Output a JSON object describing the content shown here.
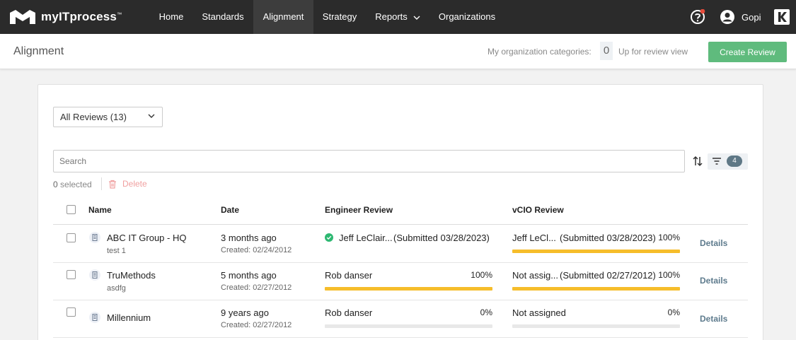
{
  "app": {
    "name": "myITprocess",
    "nav": [
      {
        "label": "Home"
      },
      {
        "label": "Standards"
      },
      {
        "label": "Alignment",
        "active": true
      },
      {
        "label": "Strategy"
      },
      {
        "label": "Reports"
      },
      {
        "label": "Organizations"
      }
    ],
    "user": "Gopi",
    "icons": {
      "help": "help-circle-icon",
      "user": "account-circle-icon",
      "brand": "kaseya-k-icon"
    },
    "notification_dot_color": "#e74c3c"
  },
  "subheader": {
    "title": "Alignment",
    "categories_label": "My organization categories:",
    "categories_count": "0",
    "review_view_label": "Up for review view",
    "create_button": "Create Review",
    "create_button_color": "#5fbb7d"
  },
  "toolbar": {
    "filter_select": "All Reviews (13)",
    "search_placeholder": "Search",
    "filter_count": "4",
    "selected_count": "0",
    "selected_label": "selected",
    "delete_label": "Delete"
  },
  "table": {
    "headers": {
      "name": "Name",
      "date": "Date",
      "engineer": "Engineer Review",
      "vcio": "vCIO Review"
    },
    "rows": [
      {
        "name": "ABC IT Group - HQ",
        "subtitle": "test 1",
        "date": "3 months ago",
        "created": "Created: 02/24/2012",
        "engineer": {
          "name": "Jeff LeClair...",
          "status": "(Submitted 03/28/2023)",
          "pct": "",
          "progress": 1.0,
          "show_bar": false,
          "submitted_icon": true
        },
        "vcio": {
          "name": "Jeff LeCl...",
          "status": "(Submitted 03/28/2023)",
          "pct": "100%",
          "progress": 1.0
        },
        "details": "Details"
      },
      {
        "name": "TruMethods",
        "subtitle": "asdfg",
        "date": "5 months ago",
        "created": "Created: 02/27/2012",
        "engineer": {
          "name": "Rob danser",
          "status": "",
          "pct": "100%",
          "progress": 1.0,
          "show_bar": true,
          "submitted_icon": false
        },
        "vcio": {
          "name": "Not assig...",
          "status": "(Submitted 02/27/2012)",
          "pct": "100%",
          "progress": 1.0
        },
        "details": "Details"
      },
      {
        "name": "Millennium",
        "subtitle": "",
        "date": "9 years ago",
        "created": "Created: 02/27/2012",
        "engineer": {
          "name": "Rob danser",
          "status": "",
          "pct": "0%",
          "progress": 0.0,
          "show_bar": true,
          "submitted_icon": false
        },
        "vcio": {
          "name": "Not assigned",
          "status": "",
          "pct": "0%",
          "progress": 0.0
        },
        "details": "Details"
      }
    ],
    "progress_color": "#f6bd2b",
    "submitted_color": "#2eb872"
  }
}
